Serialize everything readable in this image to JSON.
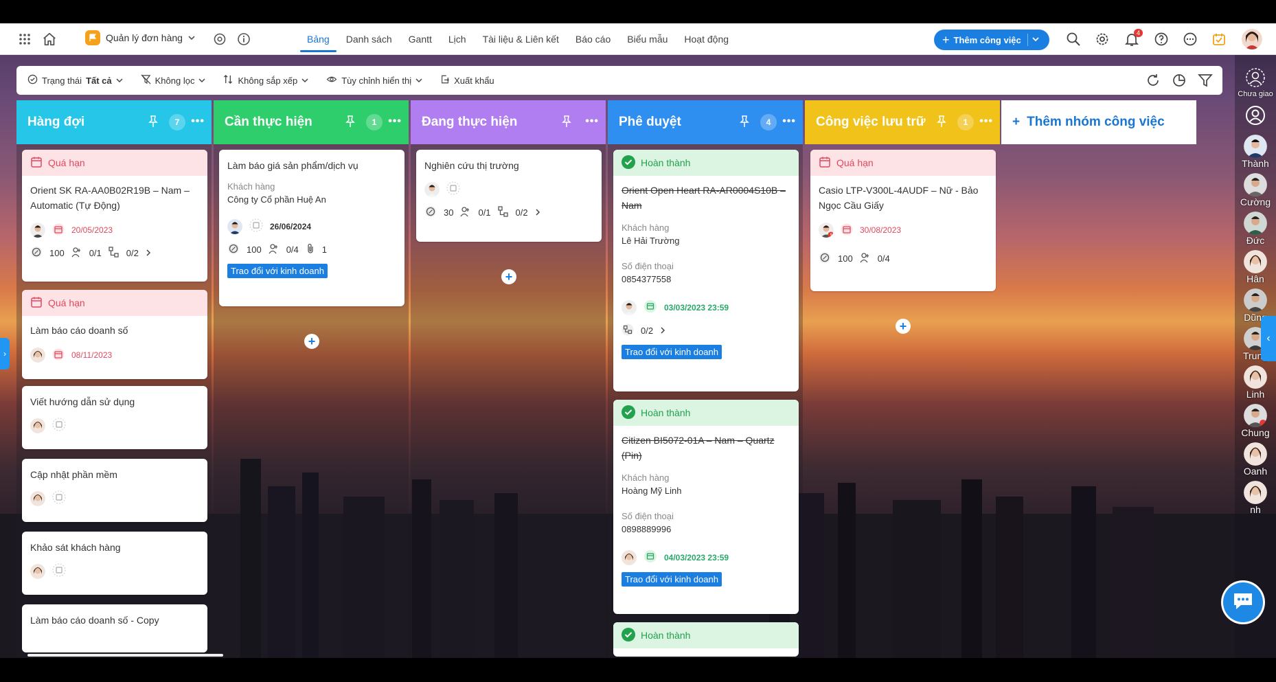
{
  "topbar": {
    "project_name": "Quản lý đơn hàng",
    "tabs": [
      {
        "label": "Bảng",
        "active": true
      },
      {
        "label": "Danh sách"
      },
      {
        "label": "Gantt"
      },
      {
        "label": "Lịch"
      },
      {
        "label": "Tài liệu & Liên kết"
      },
      {
        "label": "Báo cáo"
      },
      {
        "label": "Biểu mẫu"
      },
      {
        "label": "Hoạt động"
      }
    ],
    "add_task_label": "Thêm công việc",
    "notification_count": "4",
    "accent_color": "#1a7fe0"
  },
  "filterbar": {
    "status_label": "Trạng thái",
    "status_value": "Tất cả",
    "filter_label": "Không lọc",
    "sort_label": "Không sắp xếp",
    "display_label": "Tùy chỉnh hiển thị",
    "export_label": "Xuất khẩu"
  },
  "columns": [
    {
      "title": "Hàng đợi",
      "count": "7",
      "color": "#25c6e8",
      "cards": [
        {
          "status": "Quá hạn",
          "title": "Orient SK RA-AA0B02R19B – Nam – Automatic (Tự Động)",
          "date": "20/05/2023",
          "progress": "100",
          "assignees": "0/1",
          "subtasks": "0/2"
        },
        {
          "status": "Quá hạn",
          "title": "Làm báo cáo doanh số",
          "date": "08/11/2023"
        },
        {
          "title": "Viết hướng dẫn sử dụng"
        },
        {
          "title": "Cập nhật phần mềm"
        },
        {
          "title": "Khảo sát khách hàng"
        },
        {
          "title": "Làm báo cáo doanh số - Copy"
        }
      ]
    },
    {
      "title": "Cần thực hiện",
      "count": "1",
      "color": "#2fce6c",
      "cards": [
        {
          "title": "Làm báo giá sản phẩm/dịch vụ",
          "customer_label": "Khách hàng",
          "customer": "Công ty Cổ phần Huệ An",
          "date": "26/06/2024",
          "progress": "100",
          "assignees": "0/4",
          "attachments": "1",
          "tag": "Trao đổi với kinh doanh"
        }
      ]
    },
    {
      "title": "Đang thực hiện",
      "count": "",
      "color": "#b07ef0",
      "cards": [
        {
          "title": "Nghiên cứu thị trường",
          "progress": "30",
          "assignees": "0/1",
          "subtasks": "0/2"
        }
      ]
    },
    {
      "title": "Phê duyệt",
      "count": "4",
      "color": "#2f8ff0",
      "cards": [
        {
          "status": "Hoàn thành",
          "title": "Orient Open Heart RA-AR0004S10B – Nam",
          "customer_label": "Khách hàng",
          "customer": "Lê Hải Trường",
          "phone_label": "Số điện thoại",
          "phone": "0854377558",
          "date": "03/03/2023 23:59",
          "subtasks": "0/2",
          "tag": "Trao đổi với kinh doanh"
        },
        {
          "status": "Hoàn thành",
          "title": "Citizen BI5072-01A – Nam – Quartz (Pin)",
          "customer_label": "Khách hàng",
          "customer": "Hoàng Mỹ Linh",
          "phone_label": "Số điện thoại",
          "phone": "0898889996",
          "date": "04/03/2023 23:59",
          "tag": "Trao đổi với kinh doanh"
        },
        {
          "status": "Hoàn thành"
        }
      ]
    },
    {
      "title": "Công việc lưu trữ",
      "count": "1",
      "color": "#f0c21a",
      "cards": [
        {
          "status": "Quá hạn",
          "title": "Casio LTP-V300L-4AUDF – Nữ  - Bảo Ngọc Cầu Giấy",
          "date": "30/08/2023",
          "progress": "100",
          "assignees": "0/4"
        }
      ]
    }
  ],
  "add_group_label": "Thêm nhóm công việc",
  "members": {
    "unassigned_label": "Chưa giao",
    "names": [
      "Thành",
      "Cường",
      "Đức",
      "Hân",
      "Dũng",
      "Trung",
      "Linh",
      "Chung",
      "Oanh",
      "nh"
    ]
  }
}
